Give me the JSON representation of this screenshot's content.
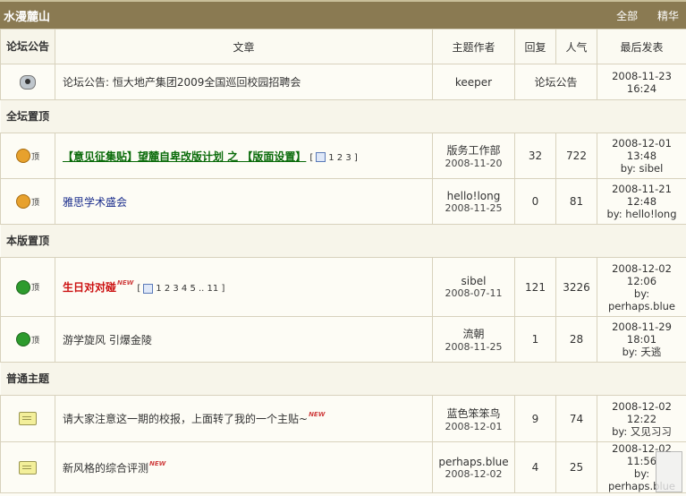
{
  "forum": {
    "name": "水漫麓山",
    "link_all": "全部",
    "link_digest": "精华"
  },
  "headers": {
    "section": "论坛公告",
    "title": "文章",
    "author": "主题作者",
    "replies": "回复",
    "views": "人气",
    "last_post": "最后发表"
  },
  "announcement": {
    "text": "论坛公告: 恒大地产集团2009全国巡回校园招聘会",
    "author": "keeper",
    "label": "论坛公告",
    "last": "2008-11-23 16:24"
  },
  "sections": {
    "global": "全坛置顶",
    "board": "本版置顶",
    "normal": "普通主题"
  },
  "icon_texts": {
    "top": "顶"
  },
  "rows": [
    {
      "title": "【意见征集贴】望麓自卑改版计划 之 【版面设置】",
      "pages": "1 2 3 ]",
      "page_prefix": "[",
      "author": "版务工作部",
      "date": "2008-11-20",
      "replies": "32",
      "views": "722",
      "last_time": "2008-12-01 13:48",
      "last_by": "by: sibel"
    },
    {
      "title": "雅思学术盛会",
      "author": "hello!long",
      "date": "2008-11-25",
      "replies": "0",
      "views": "81",
      "last_time": "2008-11-21 12:48",
      "last_by": "by: hello!long"
    },
    {
      "title": "生日对对碰",
      "newtag": "NEW",
      "pages": "1 2 3 4 5 .. 11 ]",
      "page_prefix": "[",
      "author": "sibel",
      "date": "2008-07-11",
      "replies": "121",
      "views": "3226",
      "last_time": "2008-12-02 12:06",
      "last_by": "by: perhaps.blue"
    },
    {
      "title": "游学旋风 引爆金陵",
      "author": "流朝",
      "date": "2008-11-25",
      "replies": "1",
      "views": "28",
      "last_time": "2008-11-29 18:01",
      "last_by": "by: 夭逃"
    },
    {
      "title": "请大家注意这一期的校报，上面转了我的一个主贴~",
      "newtag": "NEW",
      "author": "蓝色笨笨鸟",
      "date": "2008-12-01",
      "replies": "9",
      "views": "74",
      "last_time": "2008-12-02 12:22",
      "last_by": "by: 又见习习"
    },
    {
      "title": "新风格的综合评测",
      "newtag": "NEW",
      "author": "perhaps.blue",
      "date": "2008-12-02",
      "replies": "4",
      "views": "25",
      "last_time": "2008-12-02 11:56",
      "last_by": "by: perhaps.blue"
    }
  ]
}
